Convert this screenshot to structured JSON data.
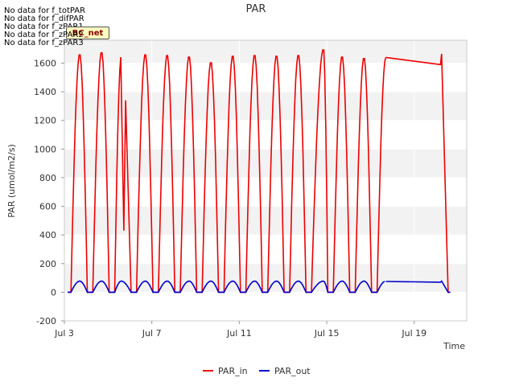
{
  "notices": [
    "No data for f_totPAR",
    "No data for f_difPAR",
    "No data for f_zPAR1",
    "No data for f_zPAR2",
    "No data for f_zPAR3"
  ],
  "badge_label": "BC_net",
  "chart_data": {
    "type": "line",
    "title": "PAR",
    "xlabel": "Time",
    "ylabel": "PAR (umol/m2/s)",
    "xlim": [
      0.0,
      18.4
    ],
    "ylim": [
      -200,
      1760
    ],
    "x_units": "days since Jul 3",
    "xticks": [
      {
        "value": 0,
        "label": "Jul 3"
      },
      {
        "value": 4,
        "label": "Jul 7"
      },
      {
        "value": 8,
        "label": "Jul 11"
      },
      {
        "value": 12,
        "label": "Jul 15"
      },
      {
        "value": 16,
        "label": "Jul 19"
      }
    ],
    "yticks": [
      -200,
      0,
      200,
      400,
      600,
      800,
      1000,
      1200,
      1400,
      1600
    ],
    "grid": true,
    "legend_position": "bottom",
    "series": [
      {
        "name": "PAR_in",
        "color": "#ee0000",
        "days": [
          {
            "rise": 0.3,
            "peak": 0.7,
            "set": 1.05,
            "max": 1665
          },
          {
            "rise": 1.3,
            "peak": 1.7,
            "set": 2.05,
            "max": 1680
          },
          {
            "rise": 2.3,
            "peak": 2.6,
            "set": 3.05,
            "max": 1650,
            "dip_x": 2.72,
            "dip_y": 430,
            "bump_x": 2.8,
            "bump_y": 1340
          },
          {
            "rise": 3.3,
            "peak": 3.7,
            "set": 4.05,
            "max": 1665
          },
          {
            "rise": 4.3,
            "peak": 4.7,
            "set": 5.05,
            "max": 1660
          },
          {
            "rise": 5.3,
            "peak": 5.7,
            "set": 6.05,
            "max": 1650
          },
          {
            "rise": 6.3,
            "peak": 6.7,
            "set": 7.05,
            "max": 1610
          },
          {
            "rise": 7.3,
            "peak": 7.7,
            "set": 8.05,
            "max": 1655
          },
          {
            "rise": 8.3,
            "peak": 8.7,
            "set": 9.05,
            "max": 1660
          },
          {
            "rise": 9.3,
            "peak": 9.7,
            "set": 10.05,
            "max": 1655
          },
          {
            "rise": 10.3,
            "peak": 10.7,
            "set": 11.05,
            "max": 1660
          },
          {
            "rise": 11.3,
            "peak": 11.85,
            "set": 12.05,
            "max": 1700
          },
          {
            "rise": 12.3,
            "peak": 12.7,
            "set": 13.05,
            "max": 1650
          },
          {
            "rise": 13.3,
            "peak": 13.7,
            "set": 14.05,
            "max": 1640
          },
          {
            "rise": 14.3,
            "peak": 14.7,
            "set": 15.0,
            "max": 1640
          }
        ],
        "gap_line": [
          [
            14.7,
            1640
          ],
          [
            17.2,
            1590
          ]
        ],
        "final_day": {
          "peak": 17.25,
          "max": 1665,
          "set": 17.55
        }
      },
      {
        "name": "PAR_out",
        "color": "#0000cc",
        "day_max": 78,
        "gap_line": [
          [
            14.7,
            75
          ],
          [
            17.2,
            70
          ]
        ]
      }
    ]
  }
}
